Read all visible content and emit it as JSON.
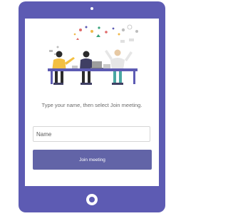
{
  "screen": {
    "prompt": "Type your name, then select Join meeting.",
    "name_field": {
      "value": "",
      "placeholder": "Name"
    },
    "join_button_label": "Join meeting"
  },
  "colors": {
    "device_frame": "#5d5bb3",
    "button": "#6264a7",
    "screen_background": "#ffffff"
  },
  "icons": {
    "illustration": "meeting-people-illustration",
    "camera": "front-camera-icon",
    "home": "home-button-icon"
  }
}
